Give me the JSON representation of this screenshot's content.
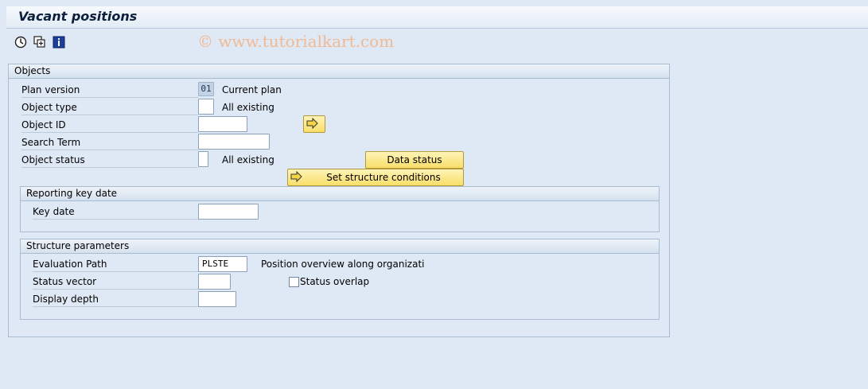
{
  "title": "Vacant positions",
  "toolbar": {
    "icons": [
      "execute-icon",
      "variant-icon",
      "info-icon"
    ],
    "watermark": "© www.tutorialkart.com"
  },
  "objects": {
    "group_label": "Objects",
    "plan_version": {
      "label": "Plan version",
      "value": "01",
      "desc": "Current plan"
    },
    "object_type": {
      "label": "Object type",
      "value": "",
      "desc": "All existing"
    },
    "object_id": {
      "label": "Object ID",
      "value": ""
    },
    "search_term": {
      "label": "Search Term",
      "value": ""
    },
    "object_status": {
      "label": "Object status",
      "value": "",
      "desc": "All existing"
    },
    "data_status_button": "Data status",
    "structure_conditions_button": "Set structure conditions"
  },
  "reporting": {
    "group_label": "Reporting key date",
    "key_date": {
      "label": "Key date",
      "value": ""
    }
  },
  "structure": {
    "group_label": "Structure parameters",
    "evaluation_path": {
      "label": "Evaluation Path",
      "value": "PLSTE",
      "desc": "Position overview along organizati"
    },
    "status_vector": {
      "label": "Status vector",
      "value": ""
    },
    "status_overlap": {
      "label": "Status overlap",
      "checked": false
    },
    "display_depth": {
      "label": "Display depth",
      "value": ""
    }
  },
  "colors": {
    "button_yellow": "#f8de68",
    "background": "#dfe9f5",
    "title_text": "#0d1f3c"
  }
}
